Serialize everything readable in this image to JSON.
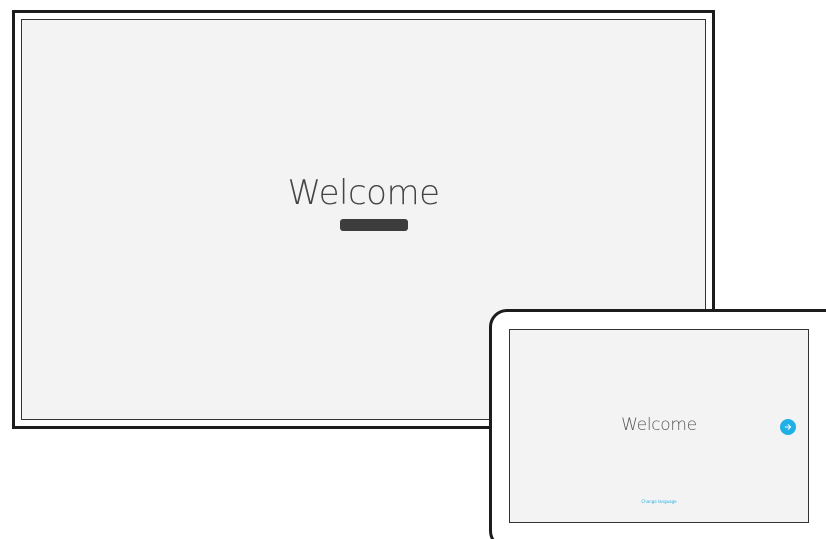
{
  "monitor": {
    "welcome_text": "Welcome",
    "status_bar_color": "#3d3d3d"
  },
  "tablet": {
    "welcome_text": "Welcome",
    "next_button": {
      "icon": "arrow-right-icon",
      "color": "#1fb0e6"
    },
    "change_language_label": "Change language"
  },
  "colors": {
    "screen_background": "#f3f3f3",
    "frame": "#1c1c1c",
    "accent": "#1fb0e6"
  }
}
